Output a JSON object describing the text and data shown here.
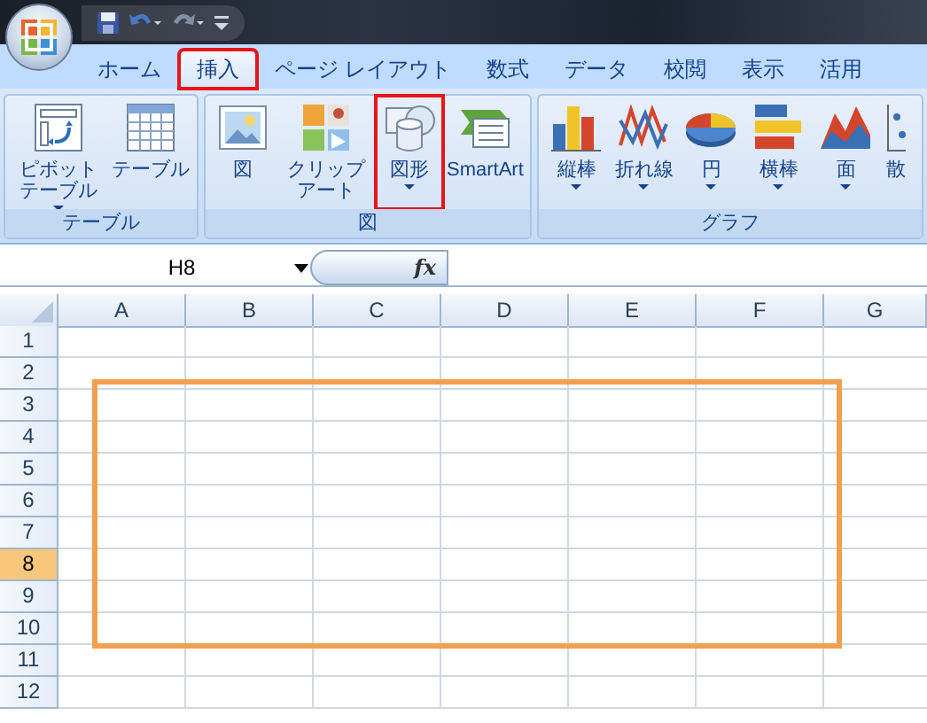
{
  "tabs": [
    {
      "label": "ホーム",
      "selected": false,
      "highlighted": false
    },
    {
      "label": "挿入",
      "selected": true,
      "highlighted": true
    },
    {
      "label": "ページ レイアウト",
      "selected": false,
      "highlighted": false
    },
    {
      "label": "数式",
      "selected": false,
      "highlighted": false
    },
    {
      "label": "データ",
      "selected": false,
      "highlighted": false
    },
    {
      "label": "校閲",
      "selected": false,
      "highlighted": false
    },
    {
      "label": "表示",
      "selected": false,
      "highlighted": false
    },
    {
      "label": "活用",
      "selected": false,
      "highlighted": false
    }
  ],
  "ribbon_groups": [
    {
      "label": "テーブル",
      "buttons": [
        {
          "kind": "pivot",
          "label": "ピボットテーブル",
          "dropdown": true,
          "highlighted": false
        },
        {
          "kind": "table",
          "label": "テーブル",
          "dropdown": false,
          "highlighted": false
        }
      ]
    },
    {
      "label": "図",
      "buttons": [
        {
          "kind": "picture",
          "label": "図",
          "dropdown": false,
          "highlighted": false
        },
        {
          "kind": "clipart",
          "label": "クリップアート",
          "dropdown": false,
          "highlighted": false
        },
        {
          "kind": "shapes",
          "label": "図形",
          "dropdown": true,
          "highlighted": true
        },
        {
          "kind": "smartart",
          "label": "SmartArt",
          "dropdown": false,
          "highlighted": false
        }
      ]
    },
    {
      "label": "グラフ",
      "buttons": [
        {
          "kind": "column",
          "label": "縦棒",
          "dropdown": true,
          "highlighted": false
        },
        {
          "kind": "line",
          "label": "折れ線",
          "dropdown": true,
          "highlighted": false
        },
        {
          "kind": "pie",
          "label": "円",
          "dropdown": true,
          "highlighted": false
        },
        {
          "kind": "bar",
          "label": "横棒",
          "dropdown": true,
          "highlighted": false
        },
        {
          "kind": "area",
          "label": "面",
          "dropdown": true,
          "highlighted": false
        },
        {
          "kind": "scatter",
          "label": "散",
          "dropdown": false,
          "highlighted": false
        }
      ]
    }
  ],
  "name_box": {
    "value": "H8"
  },
  "formula_bar": {
    "fx": "fx"
  },
  "sheet": {
    "columns": [
      "A",
      "B",
      "C",
      "D",
      "E",
      "F",
      "G"
    ],
    "rows": [
      {
        "label": "1",
        "selected": false
      },
      {
        "label": "2",
        "selected": false
      },
      {
        "label": "3",
        "selected": false
      },
      {
        "label": "4",
        "selected": false
      },
      {
        "label": "5",
        "selected": false
      },
      {
        "label": "6",
        "selected": false
      },
      {
        "label": "7",
        "selected": false
      },
      {
        "label": "8",
        "selected": true
      },
      {
        "label": "9",
        "selected": false
      },
      {
        "label": "10",
        "selected": false
      },
      {
        "label": "11",
        "selected": false
      },
      {
        "label": "12",
        "selected": false
      }
    ],
    "annotation_frame": true
  }
}
